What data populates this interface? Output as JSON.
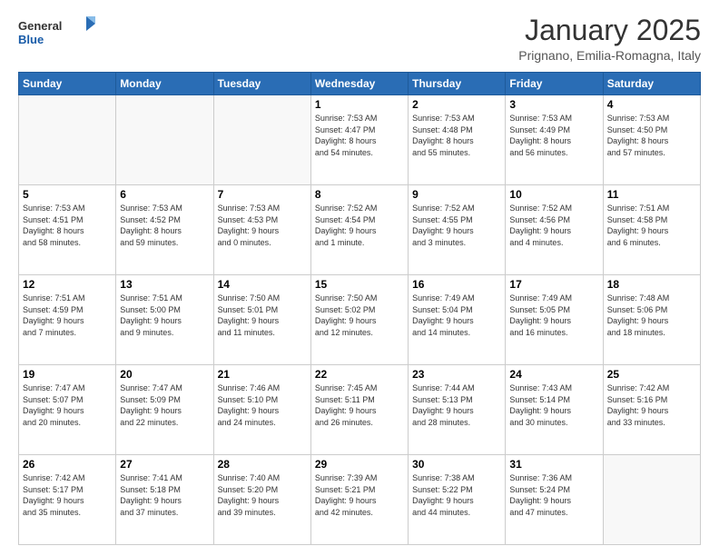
{
  "header": {
    "logo_general": "General",
    "logo_blue": "Blue",
    "month_title": "January 2025",
    "subtitle": "Prignano, Emilia-Romagna, Italy"
  },
  "days_of_week": [
    "Sunday",
    "Monday",
    "Tuesday",
    "Wednesday",
    "Thursday",
    "Friday",
    "Saturday"
  ],
  "weeks": [
    [
      {
        "day": "",
        "info": ""
      },
      {
        "day": "",
        "info": ""
      },
      {
        "day": "",
        "info": ""
      },
      {
        "day": "1",
        "info": "Sunrise: 7:53 AM\nSunset: 4:47 PM\nDaylight: 8 hours\nand 54 minutes."
      },
      {
        "day": "2",
        "info": "Sunrise: 7:53 AM\nSunset: 4:48 PM\nDaylight: 8 hours\nand 55 minutes."
      },
      {
        "day": "3",
        "info": "Sunrise: 7:53 AM\nSunset: 4:49 PM\nDaylight: 8 hours\nand 56 minutes."
      },
      {
        "day": "4",
        "info": "Sunrise: 7:53 AM\nSunset: 4:50 PM\nDaylight: 8 hours\nand 57 minutes."
      }
    ],
    [
      {
        "day": "5",
        "info": "Sunrise: 7:53 AM\nSunset: 4:51 PM\nDaylight: 8 hours\nand 58 minutes."
      },
      {
        "day": "6",
        "info": "Sunrise: 7:53 AM\nSunset: 4:52 PM\nDaylight: 8 hours\nand 59 minutes."
      },
      {
        "day": "7",
        "info": "Sunrise: 7:53 AM\nSunset: 4:53 PM\nDaylight: 9 hours\nand 0 minutes."
      },
      {
        "day": "8",
        "info": "Sunrise: 7:52 AM\nSunset: 4:54 PM\nDaylight: 9 hours\nand 1 minute."
      },
      {
        "day": "9",
        "info": "Sunrise: 7:52 AM\nSunset: 4:55 PM\nDaylight: 9 hours\nand 3 minutes."
      },
      {
        "day": "10",
        "info": "Sunrise: 7:52 AM\nSunset: 4:56 PM\nDaylight: 9 hours\nand 4 minutes."
      },
      {
        "day": "11",
        "info": "Sunrise: 7:51 AM\nSunset: 4:58 PM\nDaylight: 9 hours\nand 6 minutes."
      }
    ],
    [
      {
        "day": "12",
        "info": "Sunrise: 7:51 AM\nSunset: 4:59 PM\nDaylight: 9 hours\nand 7 minutes."
      },
      {
        "day": "13",
        "info": "Sunrise: 7:51 AM\nSunset: 5:00 PM\nDaylight: 9 hours\nand 9 minutes."
      },
      {
        "day": "14",
        "info": "Sunrise: 7:50 AM\nSunset: 5:01 PM\nDaylight: 9 hours\nand 11 minutes."
      },
      {
        "day": "15",
        "info": "Sunrise: 7:50 AM\nSunset: 5:02 PM\nDaylight: 9 hours\nand 12 minutes."
      },
      {
        "day": "16",
        "info": "Sunrise: 7:49 AM\nSunset: 5:04 PM\nDaylight: 9 hours\nand 14 minutes."
      },
      {
        "day": "17",
        "info": "Sunrise: 7:49 AM\nSunset: 5:05 PM\nDaylight: 9 hours\nand 16 minutes."
      },
      {
        "day": "18",
        "info": "Sunrise: 7:48 AM\nSunset: 5:06 PM\nDaylight: 9 hours\nand 18 minutes."
      }
    ],
    [
      {
        "day": "19",
        "info": "Sunrise: 7:47 AM\nSunset: 5:07 PM\nDaylight: 9 hours\nand 20 minutes."
      },
      {
        "day": "20",
        "info": "Sunrise: 7:47 AM\nSunset: 5:09 PM\nDaylight: 9 hours\nand 22 minutes."
      },
      {
        "day": "21",
        "info": "Sunrise: 7:46 AM\nSunset: 5:10 PM\nDaylight: 9 hours\nand 24 minutes."
      },
      {
        "day": "22",
        "info": "Sunrise: 7:45 AM\nSunset: 5:11 PM\nDaylight: 9 hours\nand 26 minutes."
      },
      {
        "day": "23",
        "info": "Sunrise: 7:44 AM\nSunset: 5:13 PM\nDaylight: 9 hours\nand 28 minutes."
      },
      {
        "day": "24",
        "info": "Sunrise: 7:43 AM\nSunset: 5:14 PM\nDaylight: 9 hours\nand 30 minutes."
      },
      {
        "day": "25",
        "info": "Sunrise: 7:42 AM\nSunset: 5:16 PM\nDaylight: 9 hours\nand 33 minutes."
      }
    ],
    [
      {
        "day": "26",
        "info": "Sunrise: 7:42 AM\nSunset: 5:17 PM\nDaylight: 9 hours\nand 35 minutes."
      },
      {
        "day": "27",
        "info": "Sunrise: 7:41 AM\nSunset: 5:18 PM\nDaylight: 9 hours\nand 37 minutes."
      },
      {
        "day": "28",
        "info": "Sunrise: 7:40 AM\nSunset: 5:20 PM\nDaylight: 9 hours\nand 39 minutes."
      },
      {
        "day": "29",
        "info": "Sunrise: 7:39 AM\nSunset: 5:21 PM\nDaylight: 9 hours\nand 42 minutes."
      },
      {
        "day": "30",
        "info": "Sunrise: 7:38 AM\nSunset: 5:22 PM\nDaylight: 9 hours\nand 44 minutes."
      },
      {
        "day": "31",
        "info": "Sunrise: 7:36 AM\nSunset: 5:24 PM\nDaylight: 9 hours\nand 47 minutes."
      },
      {
        "day": "",
        "info": ""
      }
    ]
  ]
}
